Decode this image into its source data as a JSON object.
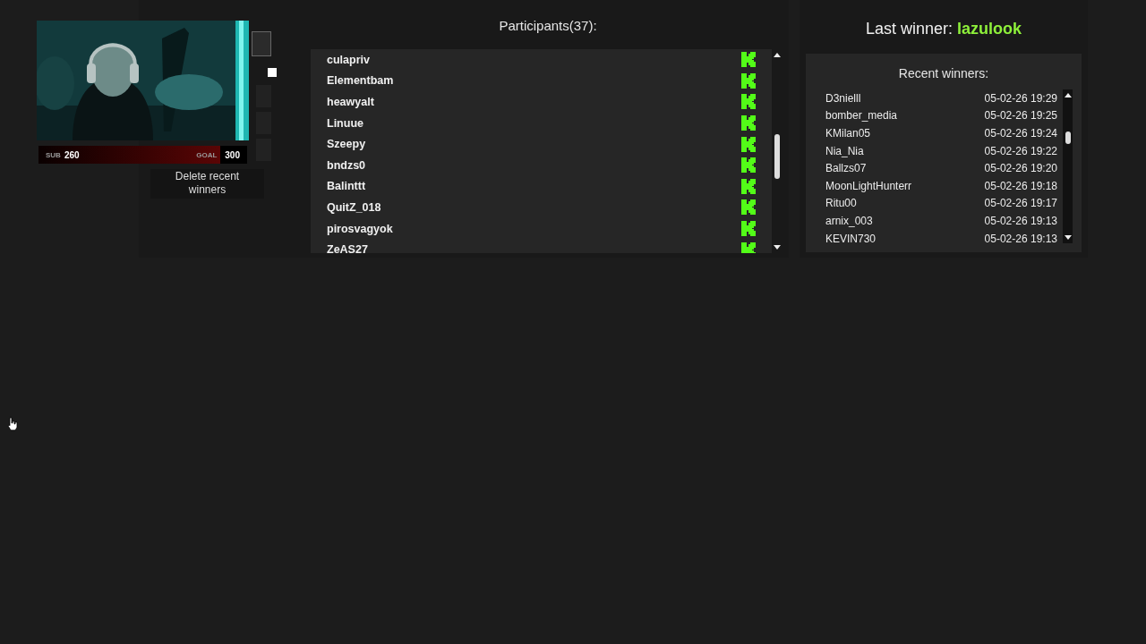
{
  "stream_overlay": {
    "kind": "picture",
    "goal_bar": {
      "sub_label": "SUB",
      "sub_count": "260",
      "goal_label": "GOAL",
      "goal_count": "300",
      "level": 0.87
    }
  },
  "controls": {
    "option_checkbox": {
      "checked": false
    },
    "delete_button": "Delete recent winners"
  },
  "participants": {
    "title": "Participants(37):",
    "items": [
      {
        "name": "culapriv"
      },
      {
        "name": "Elementbam"
      },
      {
        "name": "heawyalt"
      },
      {
        "name": "Linuue"
      },
      {
        "name": "Szeepy"
      },
      {
        "name": "bndzs0"
      },
      {
        "name": "Balinttt"
      },
      {
        "name": "QuitZ_018"
      },
      {
        "name": "pirosvagyok"
      },
      {
        "name": "ZeAS27"
      }
    ]
  },
  "last_winner": {
    "label": "Last winner:",
    "name": "lazulook"
  },
  "recent_winners": {
    "title": "Recent winners:",
    "rows": [
      {
        "name": "D3nielll",
        "time": "05-02-26 19:29"
      },
      {
        "name": "bomber_media",
        "time": "05-02-26 19:25"
      },
      {
        "name": "KMilan05",
        "time": "05-02-26 19:24"
      },
      {
        "name": "Nia_Nia",
        "time": "05-02-26 19:22"
      },
      {
        "name": "Ballzs07",
        "time": "05-02-26 19:20"
      },
      {
        "name": "MoonLightHunterr",
        "time": "05-02-26 19:18"
      },
      {
        "name": "Ritu00",
        "time": "05-02-26 19:17"
      },
      {
        "name": "arnix_003",
        "time": "05-02-26 19:13"
      },
      {
        "name": "KEVIN730",
        "time": "05-02-26 19:13"
      }
    ]
  }
}
